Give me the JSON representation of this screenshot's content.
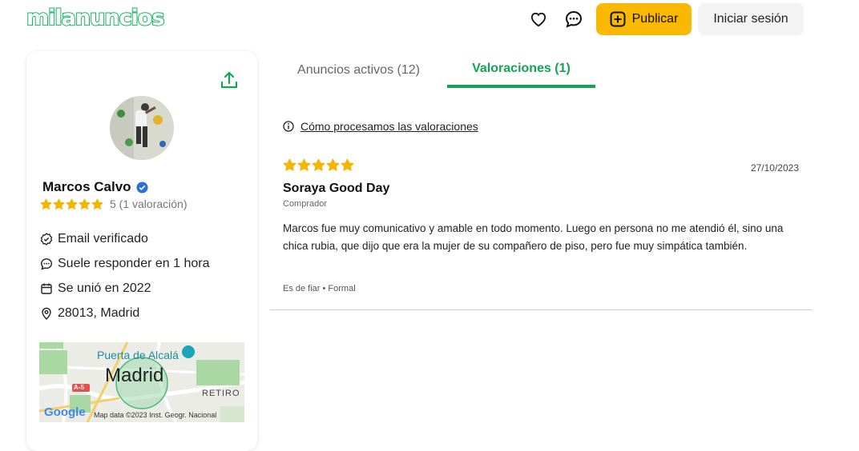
{
  "header": {
    "logo": "milanuncios",
    "publish_label": "Publicar",
    "login_label": "Iniciar sesión"
  },
  "profile": {
    "name": "Marcos Calvo",
    "rating_text": "5 (1 valoración)",
    "rating_stars": 5,
    "info": [
      {
        "icon": "verified-check-icon",
        "label": "Email verificado"
      },
      {
        "icon": "chat-icon",
        "label": "Suele responder en 1 hora"
      },
      {
        "icon": "calendar-icon",
        "label": "Se unió en 2022"
      },
      {
        "icon": "location-pin-icon",
        "label": "28013, Madrid"
      }
    ],
    "map": {
      "city": "Madrid",
      "landmark": "Puerta de Alcalá",
      "district": "RETIRO",
      "road": "A-5",
      "attribution": "Map data ©2023 Inst. Geogr. Nacional",
      "google": "Google"
    }
  },
  "tabs": [
    {
      "label": "Anuncios activos (12)",
      "active": false
    },
    {
      "label": "Valoraciones (1)",
      "active": true
    }
  ],
  "how_link": "Cómo procesamos las valoraciones",
  "review": {
    "stars": 5,
    "date": "27/10/2023",
    "author": "Soraya Good Day",
    "role": "Comprador",
    "text": "Marcos fue muy comunicativo y amable en todo momento. Luego en persona no me atendió él, sino una chica rubia, que dijo que era la mujer de su compañero de piso, pero fue muy simpática también.",
    "tags": "Es de fiar • Formal"
  },
  "colors": {
    "brand_green": "#12a454",
    "publish_yellow": "#fbb800",
    "star_yellow": "#f7b500"
  }
}
